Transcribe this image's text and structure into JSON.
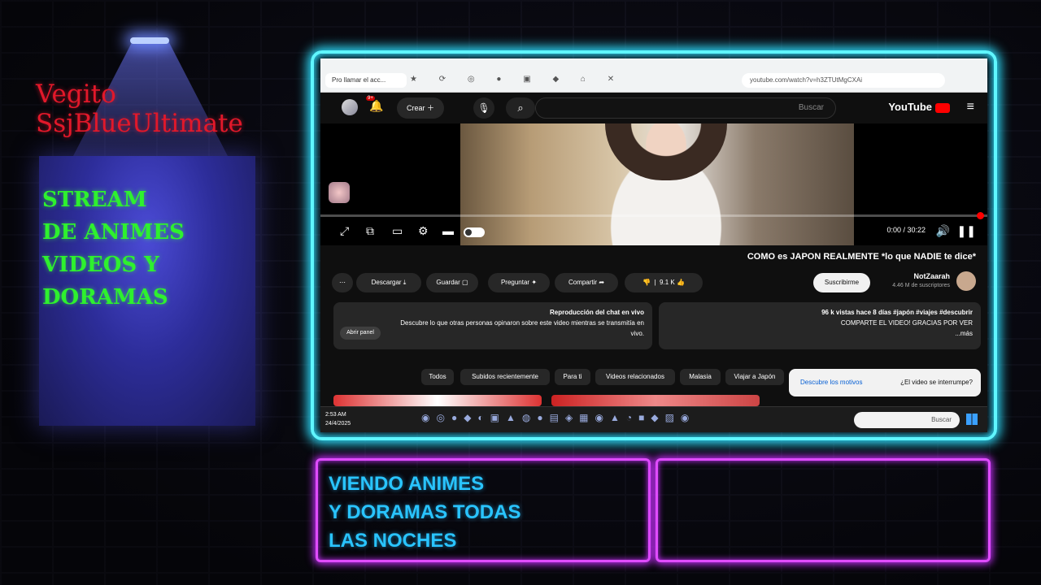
{
  "overlay": {
    "channel_name_line1": "Vegito",
    "channel_name_line2": "SsjBlueUltimate",
    "stream_lines": [
      "STREAM",
      "DE ANIMES",
      "VIDEOS Y",
      "DORAMAS"
    ],
    "bottom_box_lines": [
      "VIENDO ANIMES",
      "Y DORAMAS TODAS",
      "LAS NOCHES"
    ],
    "colors": {
      "channel": "#e2182a",
      "stream": "#2ef12e",
      "frame": "#5ff6ff",
      "bottom_box": "#e04cff",
      "bottom_text": "#29c4ff"
    }
  },
  "browser": {
    "tab_title": "Pro llamar el acc...",
    "url": "youtube.com/watch?v=h3ZTUtMgCXAi"
  },
  "youtube": {
    "logo_text": "YouTube",
    "search_placeholder": "Buscar",
    "create_label": "Crear",
    "notification_count": "9+",
    "player": {
      "time": "0:00 / 30:22"
    },
    "title": "COMO es JAPON REALMENTE *lo que NADIE te dice*",
    "channel": "NotZaarah",
    "subscribers": "4.46 M de suscriptores",
    "subscribe_label": "Suscribirme",
    "actions": {
      "like": "9.1 K",
      "share": "Compartir",
      "ask": "Preguntar",
      "save": "Guardar",
      "download": "Descargar"
    },
    "description": {
      "line1": "96 k vistas hace 8 días #japón #viajes #descubrir",
      "line2": "COMPARTE EL VIDEO! GRACIAS POR VER",
      "more": "...más"
    },
    "chat": {
      "title": "Reproducción del chat en vivo",
      "text": "Descubre lo que otras personas opinaron sobre este video mientras se transmitía en vivo.",
      "button": "Abrir panel"
    },
    "chips": [
      "Todos",
      "Subidos recientemente",
      "Para ti",
      "Videos relacionados",
      "Malasia",
      "Viajar a Japón"
    ],
    "info_banner": {
      "question": "¿El video se interrumpe?",
      "link": "Descubre los motivos"
    }
  },
  "taskbar": {
    "search_placeholder": "Buscar",
    "time": "2:53 AM",
    "date": "24/4/2025"
  }
}
